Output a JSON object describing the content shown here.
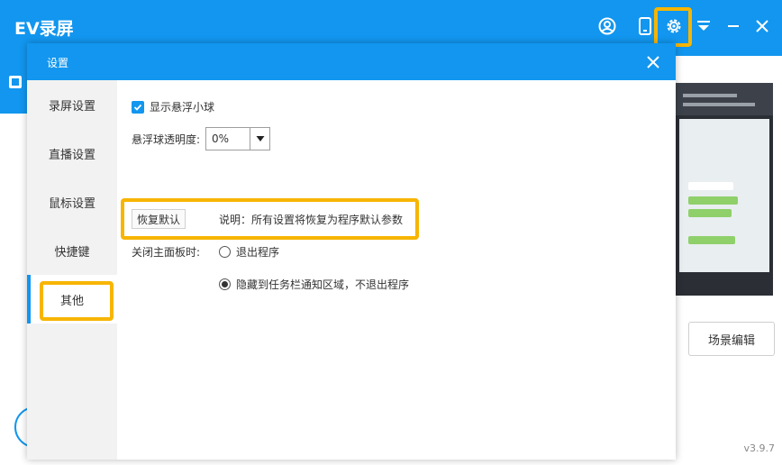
{
  "app": {
    "title": "EV录屏",
    "version": "v3.9.7"
  },
  "colors": {
    "accent": "#1296ef",
    "highlight": "#f7b500"
  },
  "titlebar_icons": [
    "user-circle-icon",
    "mobile-icon",
    "gear-icon",
    "dropdown-icon",
    "minimize-icon",
    "close-icon"
  ],
  "main": {
    "scene_edit_label": "场景编辑"
  },
  "dialog": {
    "title": "设置",
    "nav": [
      {
        "label": "录屏设置",
        "active": false
      },
      {
        "label": "直播设置",
        "active": false
      },
      {
        "label": "鼠标设置",
        "active": false
      },
      {
        "label": "快捷键",
        "active": false
      },
      {
        "label": "其他",
        "active": true
      }
    ],
    "other": {
      "show_float_ball": {
        "label": "显示悬浮小球",
        "checked": true
      },
      "opacity": {
        "label": "悬浮球透明度:",
        "value": "0%"
      },
      "restore": {
        "button_label": "恢复默认",
        "note": "说明：所有设置将恢复为程序默认参数"
      },
      "close_panel": {
        "label": "关闭主面板时:",
        "options": [
          {
            "label": "退出程序",
            "selected": false
          },
          {
            "label": "隐藏到任务栏通知区域，不退出程序",
            "selected": true
          }
        ]
      }
    }
  }
}
